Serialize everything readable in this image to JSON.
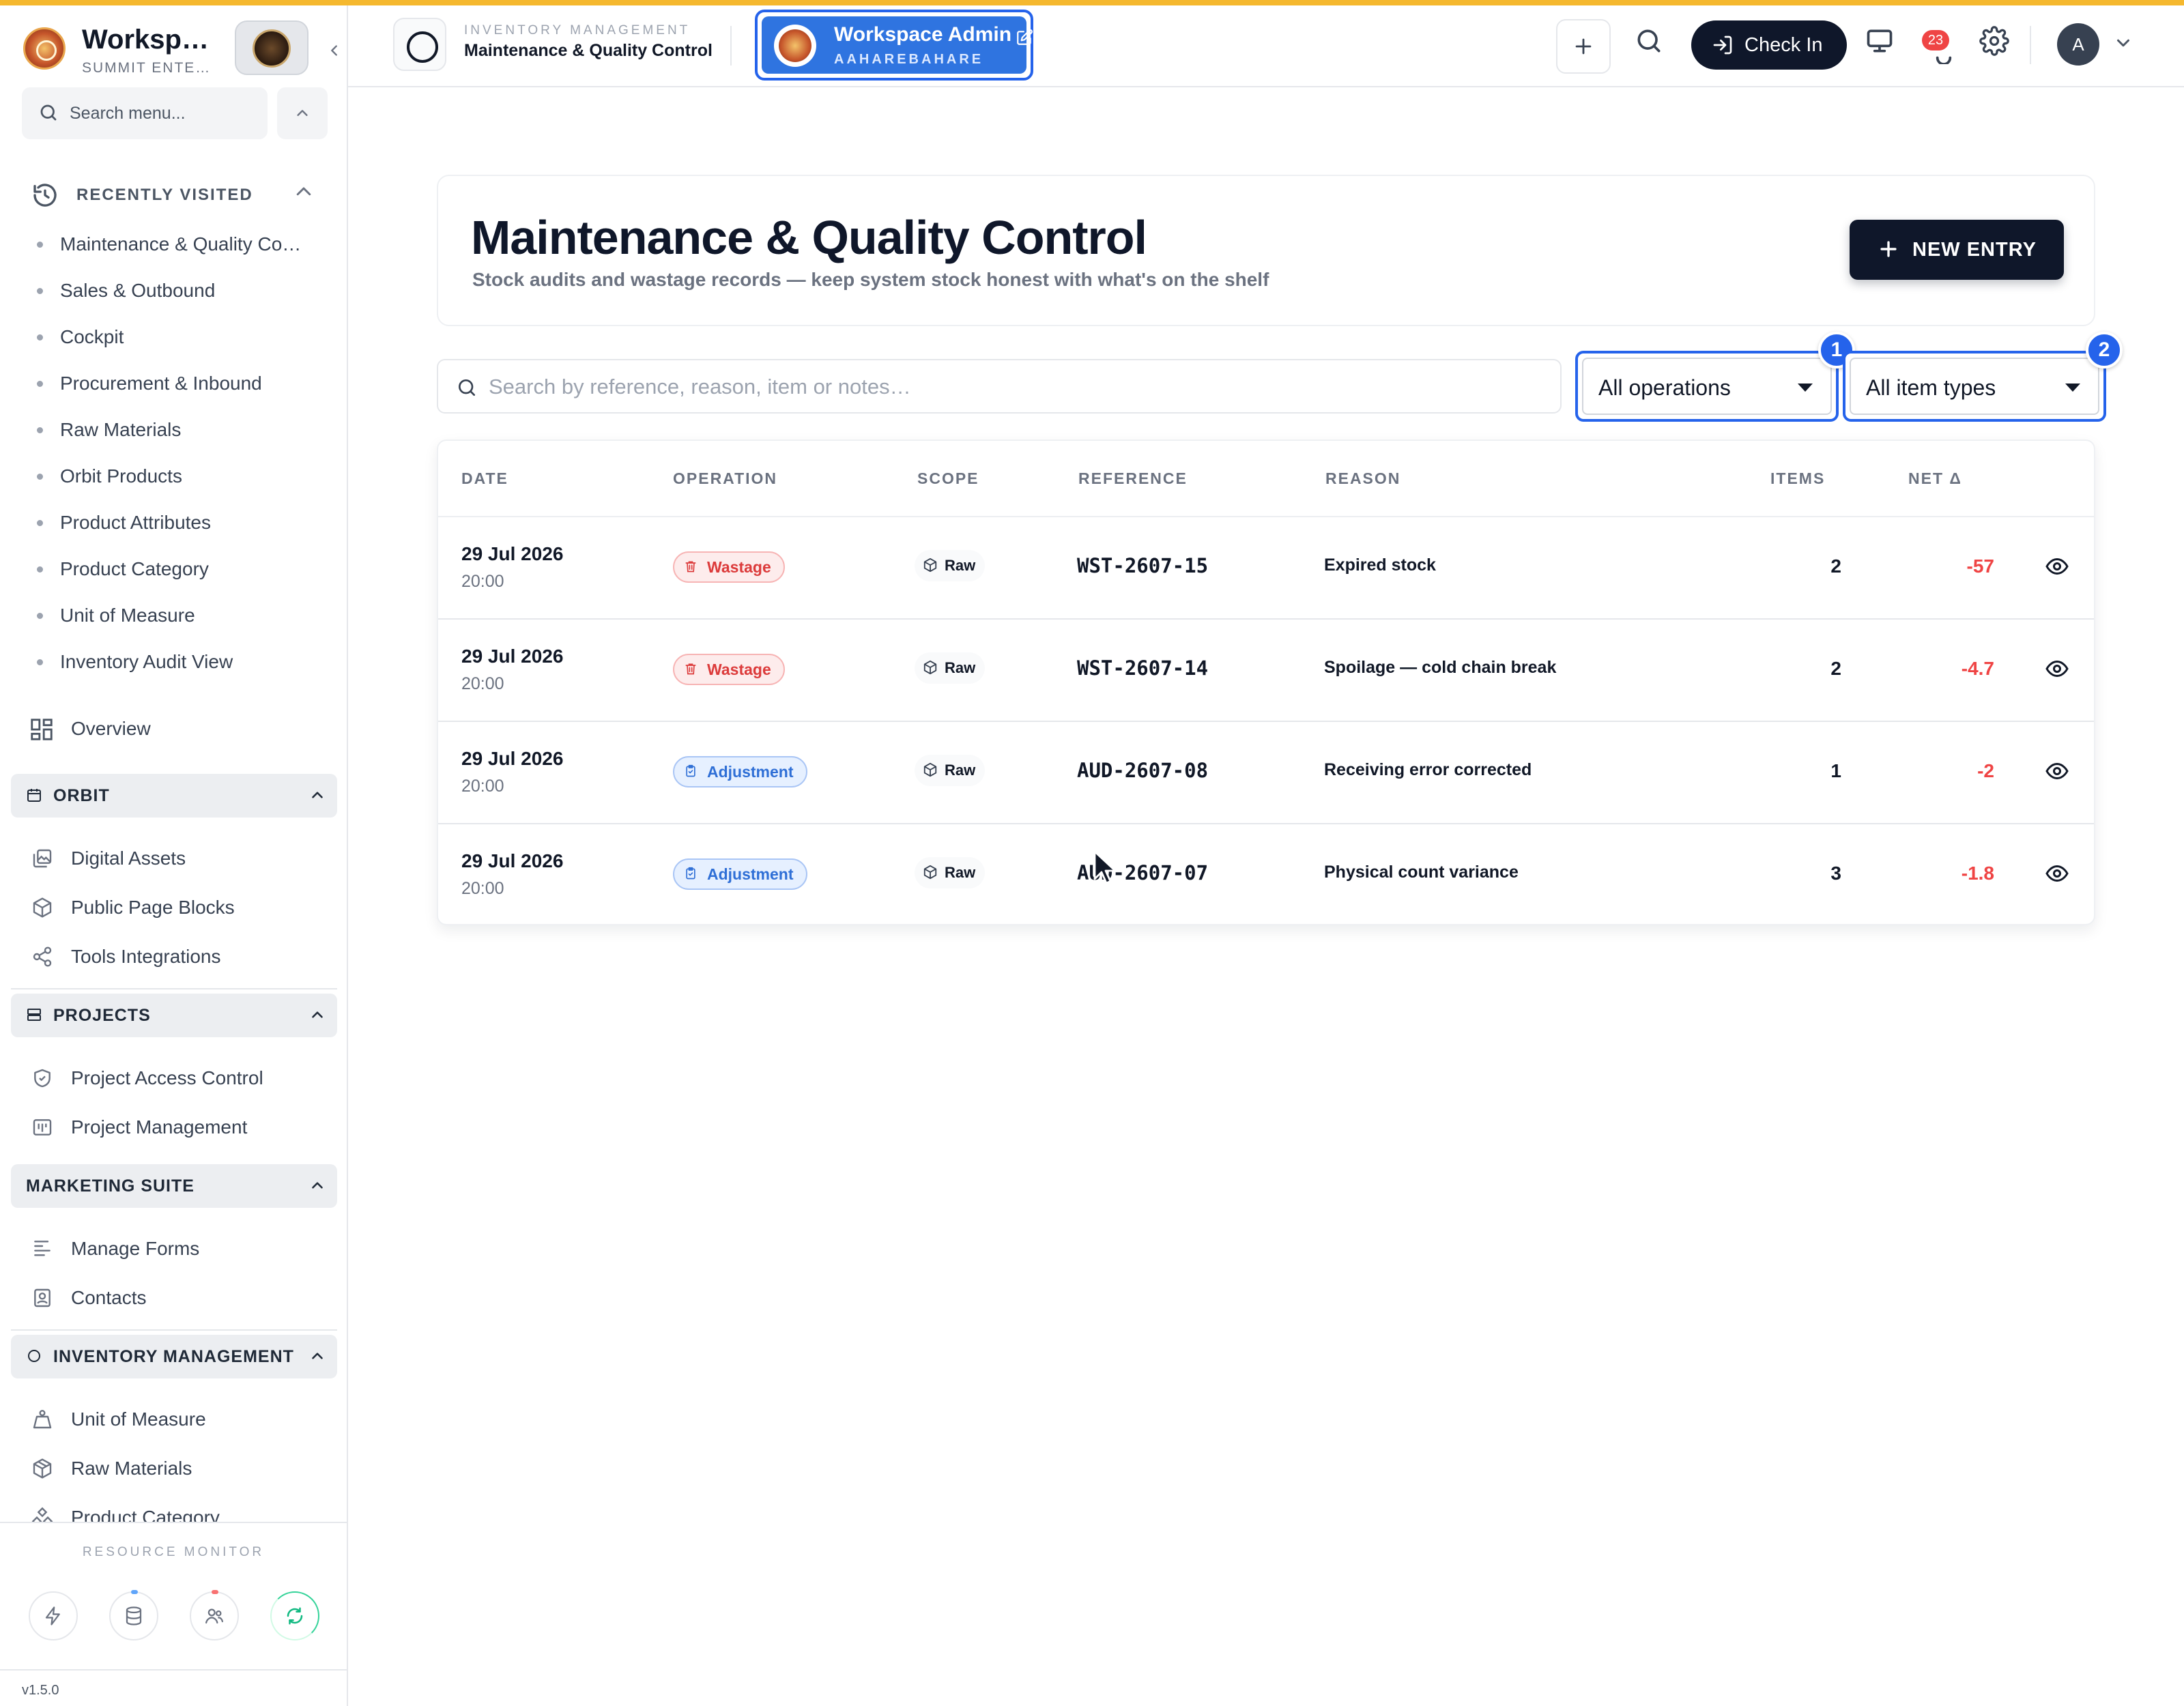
{
  "brand": {
    "title": "Worksp…",
    "subtitle": "SUMMIT ENTE…"
  },
  "menu_search": {
    "placeholder": "Search menu..."
  },
  "recently_visited": {
    "label": "RECENTLY VISITED",
    "items": [
      "Maintenance & Quality Co…",
      "Sales & Outbound",
      "Cockpit",
      "Procurement & Inbound",
      "Raw Materials",
      "Orbit Products",
      "Product Attributes",
      "Product Category",
      "Unit of Measure",
      "Inventory Audit View"
    ]
  },
  "overview": {
    "label": "Overview"
  },
  "sections": {
    "orbit": {
      "label": "ORBIT",
      "items": [
        "Digital Assets",
        "Public Page Blocks",
        "Tools Integrations"
      ]
    },
    "projects": {
      "label": "PROJECTS",
      "items": [
        "Project Access Control",
        "Project Management"
      ]
    },
    "marketing": {
      "label": "MARKETING SUITE",
      "items": [
        "Manage Forms",
        "Contacts"
      ]
    },
    "inventory": {
      "label": "INVENTORY MANAGEMENT",
      "items": [
        "Unit of Measure",
        "Raw Materials",
        "Product Category"
      ]
    }
  },
  "resource_monitor": {
    "title": "RESOURCE MONITOR"
  },
  "version": "v1.5.0",
  "topbar": {
    "module_kicker": "INVENTORY MANAGEMENT",
    "module_title": "Maintenance & Quality Control",
    "workspace_title": "Workspace Admin",
    "workspace_sub": "AAHAREBAHARE",
    "checkin_label": "Check In",
    "notification_count": "23",
    "avatar_initial": "A"
  },
  "page": {
    "title": "Maintenance & Quality Control",
    "subtitle": "Stock audits and wastage records — keep system stock honest with what's on the shelf",
    "new_entry_label": "NEW ENTRY",
    "search_placeholder": "Search by reference, reason, item or notes…",
    "filters": [
      {
        "value": "All operations",
        "step": "1"
      },
      {
        "value": "All item types",
        "step": "2"
      }
    ]
  },
  "table": {
    "columns": [
      "DATE",
      "OPERATION",
      "SCOPE",
      "REFERENCE",
      "REASON",
      "ITEMS",
      "NET Δ"
    ],
    "rows": [
      {
        "date": "29 Jul 2026",
        "time": "20:00",
        "operation": "Wastage",
        "scope": "Raw",
        "reference": "WST-2607-15",
        "reason": "Expired stock",
        "items": "2",
        "net": "-57"
      },
      {
        "date": "29 Jul 2026",
        "time": "20:00",
        "operation": "Wastage",
        "scope": "Raw",
        "reference": "WST-2607-14",
        "reason": "Spoilage — cold chain break",
        "items": "2",
        "net": "-4.7"
      },
      {
        "date": "29 Jul 2026",
        "time": "20:00",
        "operation": "Adjustment",
        "scope": "Raw",
        "reference": "AUD-2607-08",
        "reason": "Receiving error corrected",
        "items": "1",
        "net": "-2"
      },
      {
        "date": "29 Jul 2026",
        "time": "20:00",
        "operation": "Adjustment",
        "scope": "Raw",
        "reference": "AUD-2607-07",
        "reason": "Physical count variance",
        "items": "3",
        "net": "-1.8"
      }
    ]
  },
  "colors": {
    "accent": "#2563eb",
    "top_stripe": "#f5b82e",
    "primary_dark": "#0f172a",
    "negative": "#ef4444",
    "wastage": "#dc3b3b",
    "adjustment": "#2f6fd6"
  }
}
